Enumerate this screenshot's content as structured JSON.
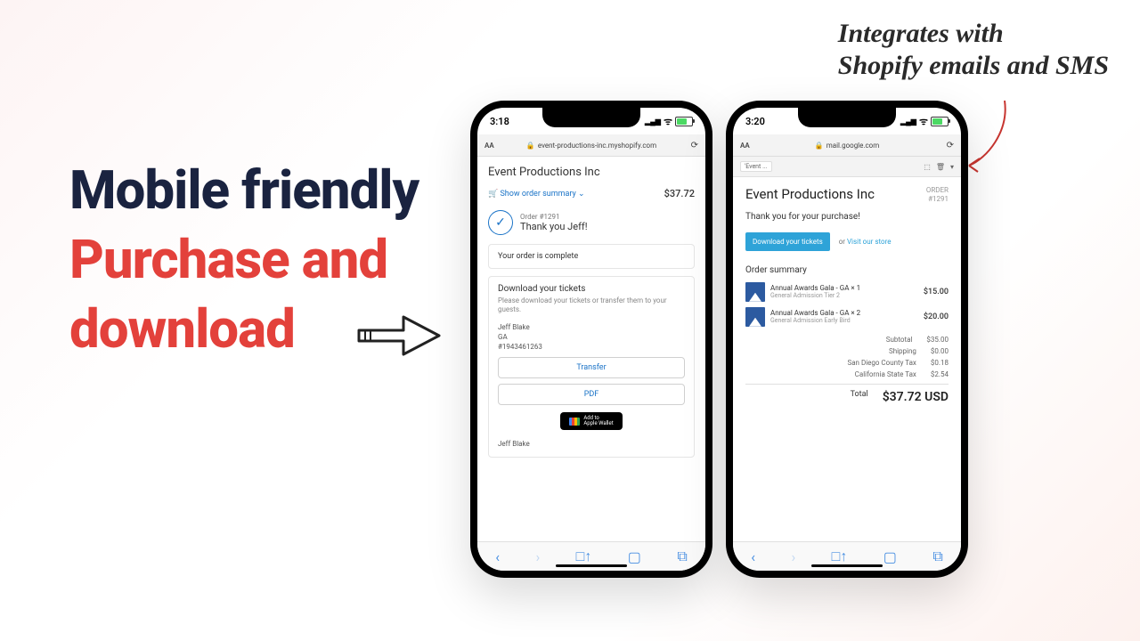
{
  "headline": {
    "line1": "Mobile friendly",
    "line2": "Purchase and",
    "line3": "download"
  },
  "annotation": {
    "line1": "Integrates with",
    "line2": "Shopify emails and SMS"
  },
  "phone1": {
    "time": "3:18",
    "url": "event-productions-inc.myshopify.com",
    "title": "Event Productions Inc",
    "summary_toggle": "Show order summary",
    "summary_price": "$37.72",
    "order_sub": "Order #1291",
    "thank": "Thank you Jeff!",
    "complete": "Your order is complete",
    "dl_title": "Download your tickets",
    "dl_sub": "Please download your tickets or transfer them to your guests.",
    "ticket": {
      "name": "Jeff Blake",
      "tier": "GA",
      "id": "#1943461263"
    },
    "transfer": "Transfer",
    "pdf": "PDF",
    "wallet": "Add to\nApple Wallet",
    "ticket2_name": "Jeff Blake"
  },
  "phone2": {
    "time": "3:20",
    "url": "mail.google.com",
    "chip": "'Event ...",
    "title": "Event Productions Inc",
    "order_lbl": "ORDER",
    "order_num": "#1291",
    "thank": "Thank you for your purchase!",
    "dl_btn": "Download your tickets",
    "or": "or",
    "visit": "Visit our store",
    "os_title": "Order summary",
    "items": [
      {
        "name": "Annual Awards Gala - GA × 1",
        "sub": "General Admission Tier 2",
        "price": "$15.00"
      },
      {
        "name": "Annual Awards Gala - GA × 2",
        "sub": "General Admission Early Bird",
        "price": "$20.00"
      }
    ],
    "totals": [
      {
        "lbl": "Subtotal",
        "val": "$35.00"
      },
      {
        "lbl": "Shipping",
        "val": "$0.00"
      },
      {
        "lbl": "San Diego County Tax",
        "val": "$0.18"
      },
      {
        "lbl": "California State Tax",
        "val": "$2.54"
      }
    ],
    "grand": {
      "lbl": "Total",
      "val": "$37.72 USD"
    }
  }
}
